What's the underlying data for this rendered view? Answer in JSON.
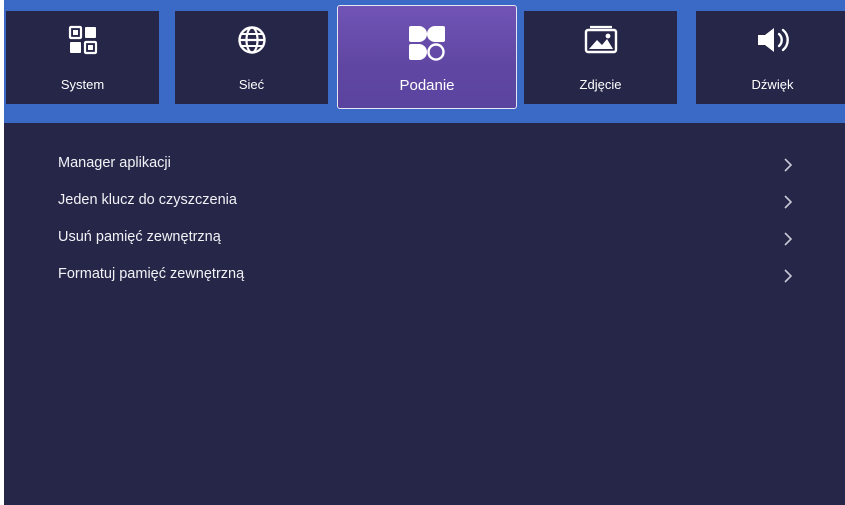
{
  "tabs": [
    {
      "label": "System",
      "icon": "system-grid-icon",
      "active": false
    },
    {
      "label": "Sieć",
      "icon": "globe-icon",
      "active": false
    },
    {
      "label": "Podanie",
      "icon": "apps-icon",
      "active": true
    },
    {
      "label": "Zdjęcie",
      "icon": "photo-icon",
      "active": false
    },
    {
      "label": "Dźwięk",
      "icon": "speaker-icon",
      "active": false
    }
  ],
  "menu": {
    "items": [
      {
        "label": "Manager aplikacji",
        "icon": "chevron-right-icon"
      },
      {
        "label": "Jeden klucz do czyszczenia",
        "icon": "chevron-right-icon"
      },
      {
        "label": "Usuń pamięć zewnętrzną",
        "icon": "chevron-right-icon"
      },
      {
        "label": "Formatuj pamięć zewnętrzną",
        "icon": "chevron-right-icon"
      }
    ]
  },
  "colors": {
    "background": "#252648",
    "topbar": "#3a69c6",
    "active_tab": "#6a4fb0",
    "text": "#ffffff"
  }
}
